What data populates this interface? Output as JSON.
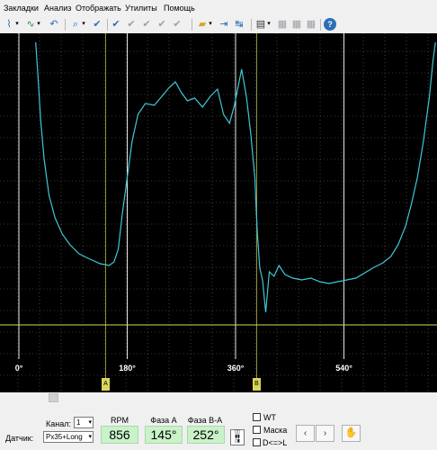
{
  "menu": [
    "Закладки",
    "Анализ",
    "Отображать",
    "Утилиты",
    "Помощь"
  ],
  "toolbar_icons": [
    "waveform-icon",
    "dropdown-arrow-icon",
    "waveform-alt-icon",
    "dropdown-arrow-icon",
    "undo-icon",
    "zoom-icon",
    "dropdown-arrow-icon",
    "check-icon",
    "check-double-icon",
    "check-triple-icon",
    "check-quad-icon",
    "folder-open-icon",
    "dropdown-arrow-icon",
    "cursor-right-icon",
    "cursor-split-icon",
    "cursor-left-icon",
    "window-icon",
    "dropdown-arrow-icon",
    "grid-icon",
    "grid-alt-icon",
    "grid-off-icon",
    "help-icon"
  ],
  "scope": {
    "background": "#000000",
    "trace_color": "#3fc8d6",
    "baseline_color": "#d7d75a",
    "markers": [
      "0°",
      "180°",
      "360°",
      "540°"
    ],
    "cursor_a_label": "A",
    "cursor_b_label": "B"
  },
  "chart_data": {
    "type": "line",
    "x_ticks": [
      "0°",
      "180°",
      "360°",
      "540°"
    ],
    "xlim_deg": [
      -12,
      690
    ],
    "series": [
      {
        "points_deg": [
          [
            28,
            0
          ],
          [
            32,
            40
          ],
          [
            36,
            85
          ],
          [
            42,
            130
          ],
          [
            50,
            170
          ],
          [
            60,
            195
          ],
          [
            72,
            213
          ],
          [
            85,
            225
          ],
          [
            100,
            235
          ],
          [
            115,
            240
          ],
          [
            135,
            246
          ],
          [
            150,
            248
          ],
          [
            158,
            244
          ],
          [
            165,
            230
          ],
          [
            172,
            190
          ],
          [
            180,
            150
          ],
          [
            188,
            110
          ],
          [
            198,
            80
          ],
          [
            210,
            68
          ],
          [
            225,
            70
          ],
          [
            240,
            58
          ],
          [
            250,
            50
          ],
          [
            260,
            44
          ],
          [
            270,
            56
          ],
          [
            280,
            65
          ],
          [
            292,
            62
          ],
          [
            305,
            72
          ],
          [
            318,
            60
          ],
          [
            330,
            52
          ],
          [
            340,
            80
          ],
          [
            350,
            90
          ],
          [
            358,
            70
          ],
          [
            370,
            30
          ],
          [
            378,
            60
          ],
          [
            385,
            100
          ],
          [
            392,
            150
          ],
          [
            396,
            210
          ],
          [
            400,
            250
          ],
          [
            405,
            265
          ],
          [
            410,
            300
          ],
          [
            416,
            255
          ],
          [
            424,
            260
          ],
          [
            432,
            248
          ],
          [
            442,
            258
          ],
          [
            455,
            262
          ],
          [
            470,
            264
          ],
          [
            485,
            262
          ],
          [
            500,
            266
          ],
          [
            515,
            268
          ],
          [
            530,
            266
          ],
          [
            545,
            264
          ],
          [
            560,
            262
          ],
          [
            575,
            256
          ],
          [
            590,
            250
          ],
          [
            605,
            245
          ],
          [
            618,
            238
          ],
          [
            630,
            225
          ],
          [
            642,
            205
          ],
          [
            652,
            180
          ],
          [
            662,
            150
          ],
          [
            672,
            110
          ],
          [
            682,
            60
          ],
          [
            688,
            20
          ],
          [
            692,
            0
          ]
        ]
      }
    ]
  },
  "bottom": {
    "channel_label": "Канал:",
    "channel_value": "1",
    "sensor_label": "Датчик:",
    "sensor_value": "Px35+Long",
    "rpm_label": "RPM",
    "rpm_value": "856",
    "phase_a_label": "Фаза А",
    "phase_a_value": "145°",
    "phase_ba_label": "Фаза В-А",
    "phase_ba_value": "252°",
    "wt_label": "WT",
    "mask_label": "Маска",
    "dl_label": "D<=>L",
    "prev_symbol": "‹",
    "next_symbol": "›",
    "hand_symbol": "✋"
  }
}
